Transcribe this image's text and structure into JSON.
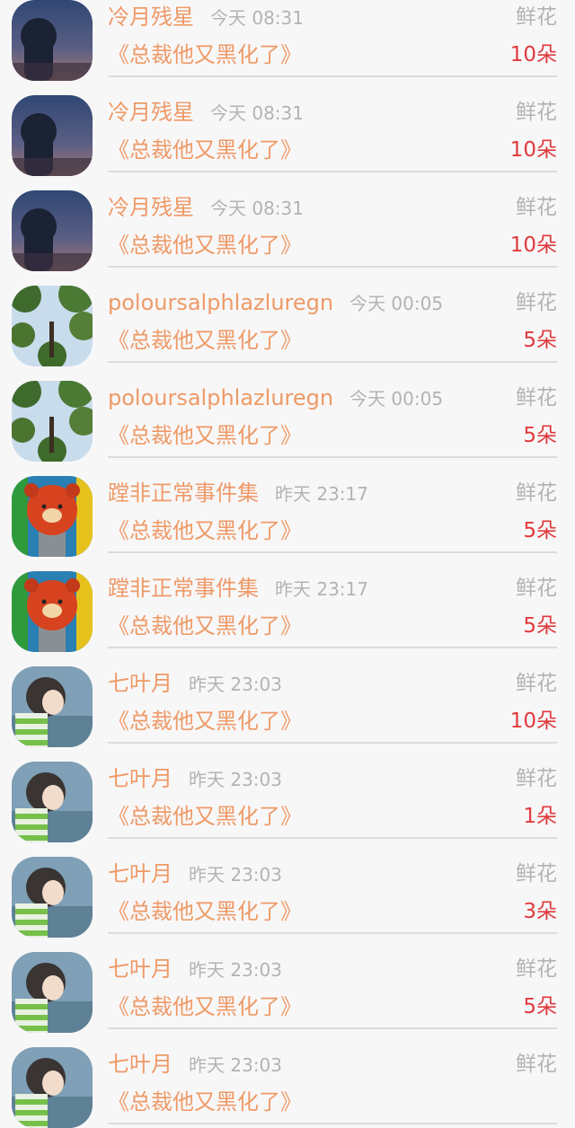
{
  "list": {
    "items": [
      {
        "user": "冷月残星",
        "time": "今天 08:31",
        "gift": "鲜花",
        "book": "《总裁他又黑化了》",
        "count": "10朵",
        "avatar": "night-girl-avatar-icon"
      },
      {
        "user": "冷月残星",
        "time": "今天 08:31",
        "gift": "鲜花",
        "book": "《总裁他又黑化了》",
        "count": "10朵",
        "avatar": "night-girl-avatar-icon"
      },
      {
        "user": "冷月残星",
        "time": "今天 08:31",
        "gift": "鲜花",
        "book": "《总裁他又黑化了》",
        "count": "10朵",
        "avatar": "night-girl-avatar-icon"
      },
      {
        "user": "poloursalphlazluregn",
        "time": "今天 00:05",
        "gift": "鲜花",
        "book": "《总裁他又黑化了》",
        "count": "5朵",
        "avatar": "tree-sky-avatar-icon"
      },
      {
        "user": "poloursalphlazluregn",
        "time": "今天 00:05",
        "gift": "鲜花",
        "book": "《总裁他又黑化了》",
        "count": "5朵",
        "avatar": "tree-sky-avatar-icon"
      },
      {
        "user": "蹚非正常事件集",
        "time": "昨天 23:17",
        "gift": "鲜花",
        "book": "《总裁他又黑化了》",
        "count": "5朵",
        "avatar": "bear-plush-avatar-icon"
      },
      {
        "user": "蹚非正常事件集",
        "time": "昨天 23:17",
        "gift": "鲜花",
        "book": "《总裁他又黑化了》",
        "count": "5朵",
        "avatar": "bear-plush-avatar-icon"
      },
      {
        "user": "七叶月",
        "time": "昨天 23:03",
        "gift": "鲜花",
        "book": "《总裁他又黑化了》",
        "count": "10朵",
        "avatar": "anime-girl-avatar-icon"
      },
      {
        "user": "七叶月",
        "time": "昨天 23:03",
        "gift": "鲜花",
        "book": "《总裁他又黑化了》",
        "count": "1朵",
        "avatar": "anime-girl-avatar-icon"
      },
      {
        "user": "七叶月",
        "time": "昨天 23:03",
        "gift": "鲜花",
        "book": "《总裁他又黑化了》",
        "count": "3朵",
        "avatar": "anime-girl-avatar-icon"
      },
      {
        "user": "七叶月",
        "time": "昨天 23:03",
        "gift": "鲜花",
        "book": "《总裁他又黑化了》",
        "count": "5朵",
        "avatar": "anime-girl-avatar-icon"
      },
      {
        "user": "七叶月",
        "time": "昨天 23:03",
        "gift": "鲜花",
        "book": "《总裁他又黑化了》",
        "count": "",
        "avatar": "anime-girl-avatar-icon"
      }
    ]
  },
  "colors": {
    "accent": "#ee9a67",
    "count": "#e03a3c",
    "muted": "#b5b2b2",
    "background": "#f8f7f8",
    "divider": "#dcdcdc"
  }
}
